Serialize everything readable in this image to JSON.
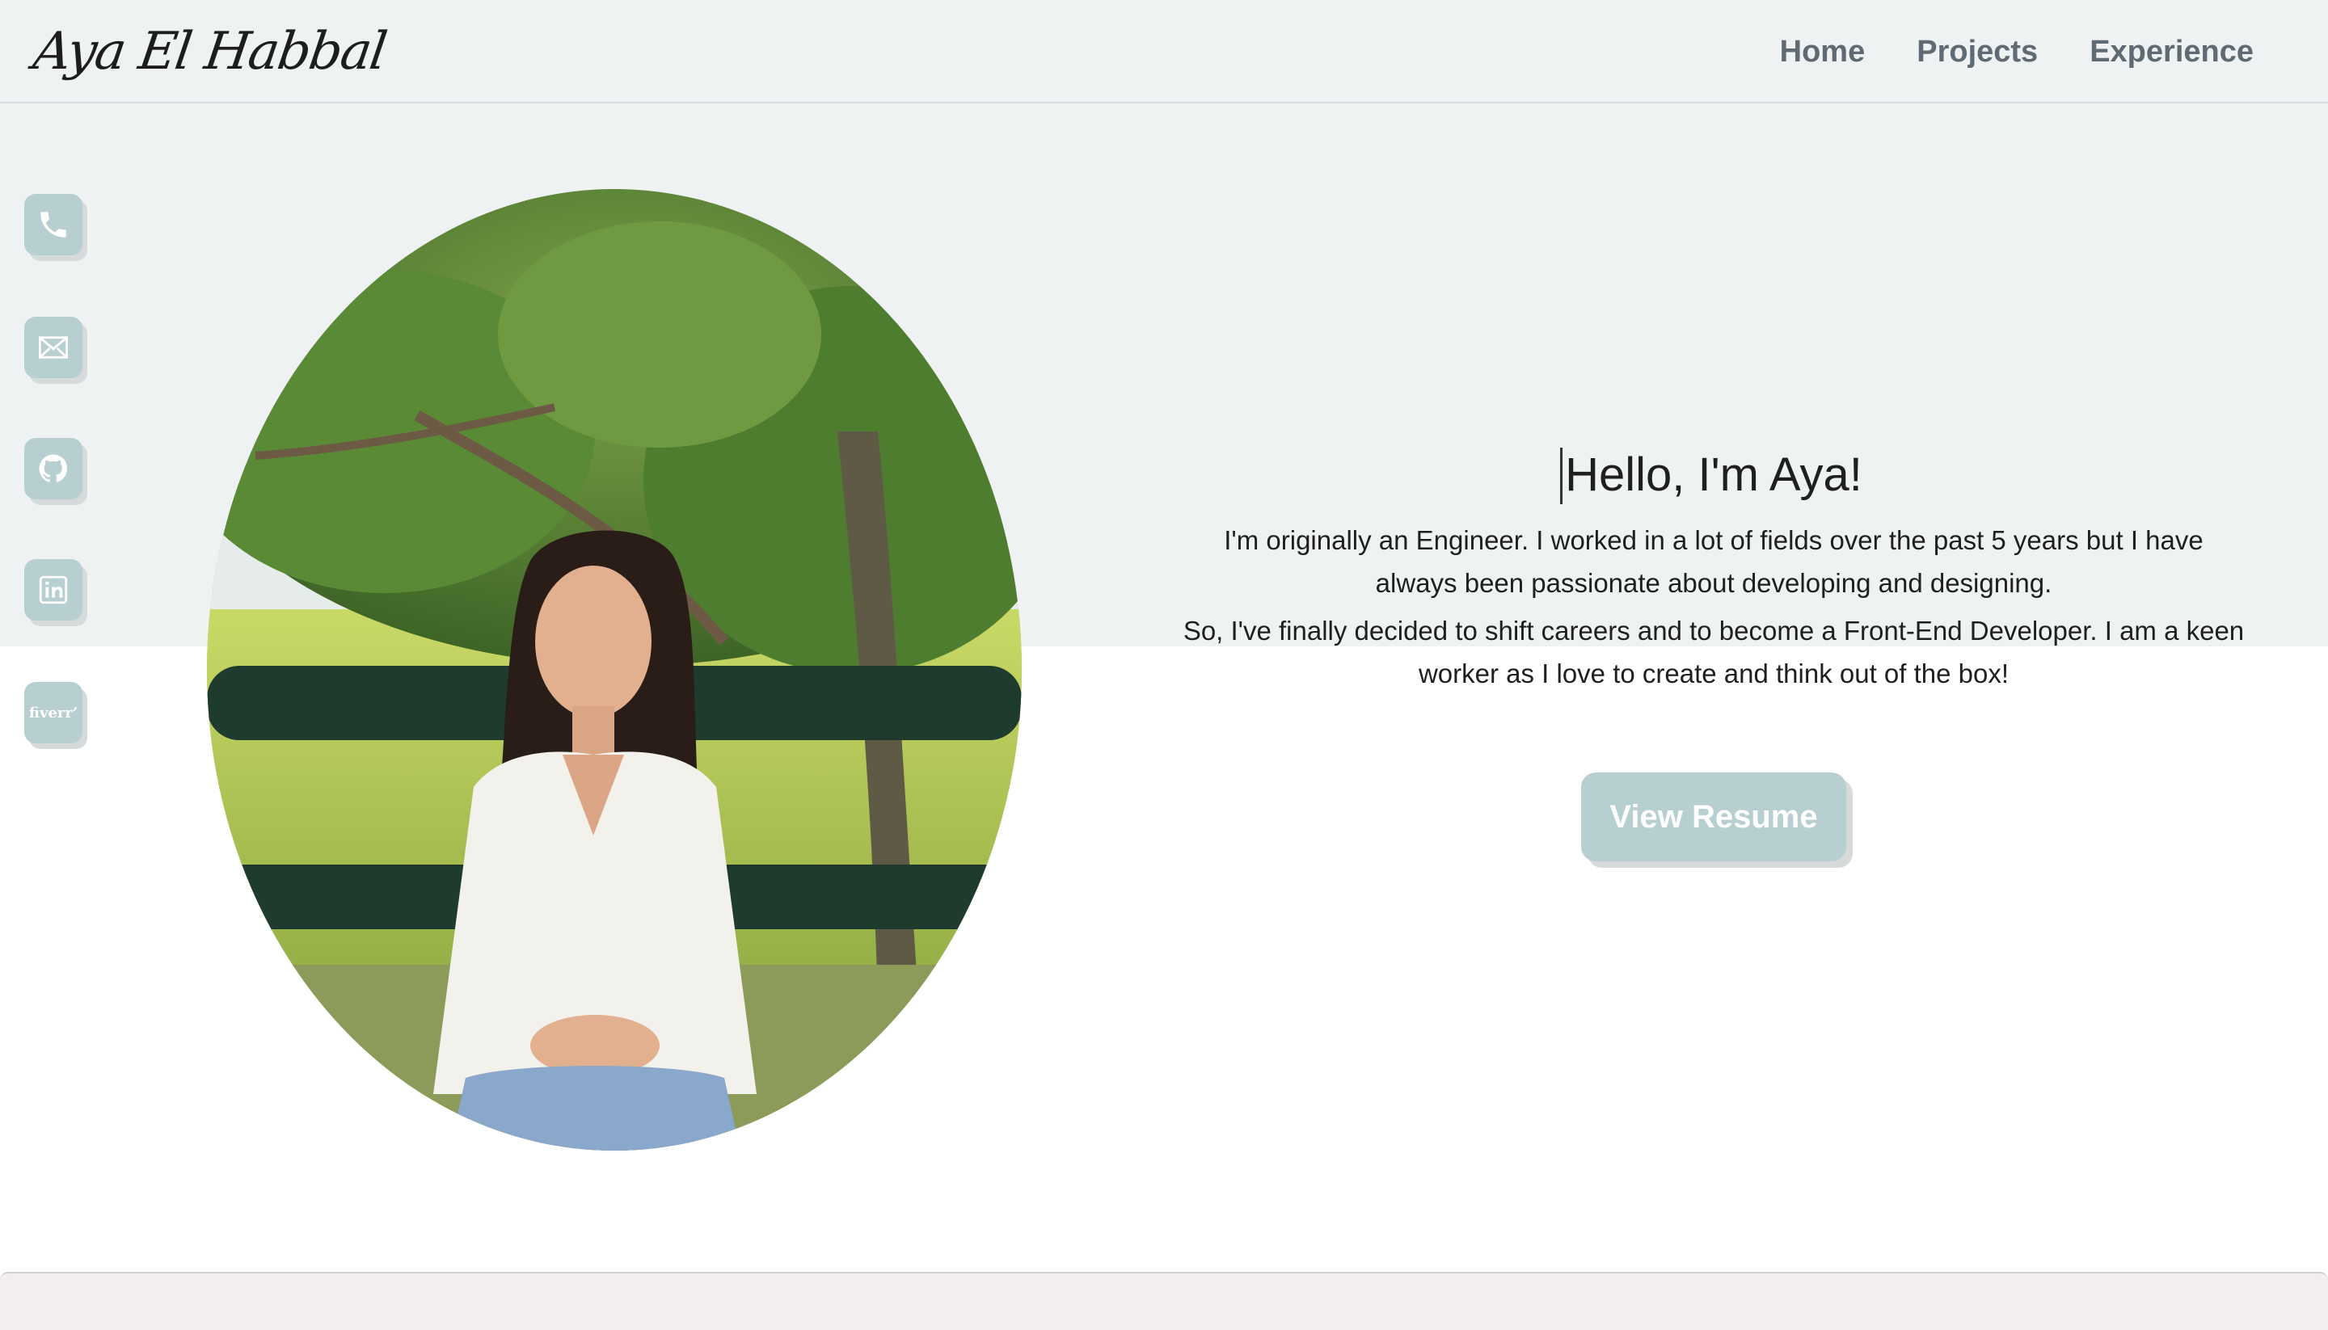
{
  "header": {
    "brand": "Aya El Habbal",
    "nav": [
      {
        "label": "Home"
      },
      {
        "label": "Projects"
      },
      {
        "label": "Experience"
      }
    ]
  },
  "social": [
    {
      "icon": "phone-icon"
    },
    {
      "icon": "mail-icon"
    },
    {
      "icon": "github-icon"
    },
    {
      "icon": "linkedin-icon"
    },
    {
      "icon": "fiverr-icon",
      "label": "fiverr"
    }
  ],
  "hero": {
    "title": "Hello, I'm Aya!",
    "paragraph1": "I'm originally an Engineer. I worked in a lot of fields over the past 5 years but I have always been passionate about developing and designing.",
    "paragraph2": "So, I've finally decided to shift careers and to become a Front-End Developer. I am a keen worker as I love to create and think out of the box!",
    "button": "View Resume"
  },
  "colors": {
    "accent": "#b7cfd0",
    "background_top": "#eff2f3",
    "nav_text": "#5f6a73"
  }
}
